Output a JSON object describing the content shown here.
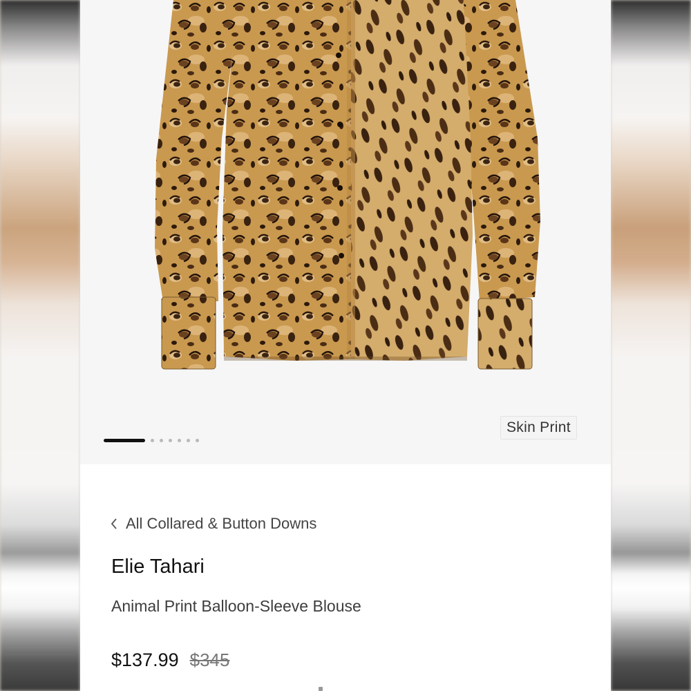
{
  "product": {
    "color_tag": "Skin Print",
    "breadcrumb": "All Collared & Button Downs",
    "brand": "Elie Tahari",
    "name": "Animal Print Balloon-Sleeve Blouse",
    "price_sale": "$137.99",
    "price_original": "$345"
  },
  "carousel": {
    "total_slides": 7,
    "active_index": 0
  },
  "icons": {
    "breadcrumb_back": "chevron-left-icon"
  },
  "colors": {
    "accent": "#111111",
    "image_bg": "#f6f6f6",
    "leopard_base": "#c9994f",
    "leopard_spot": "#3b2412"
  }
}
